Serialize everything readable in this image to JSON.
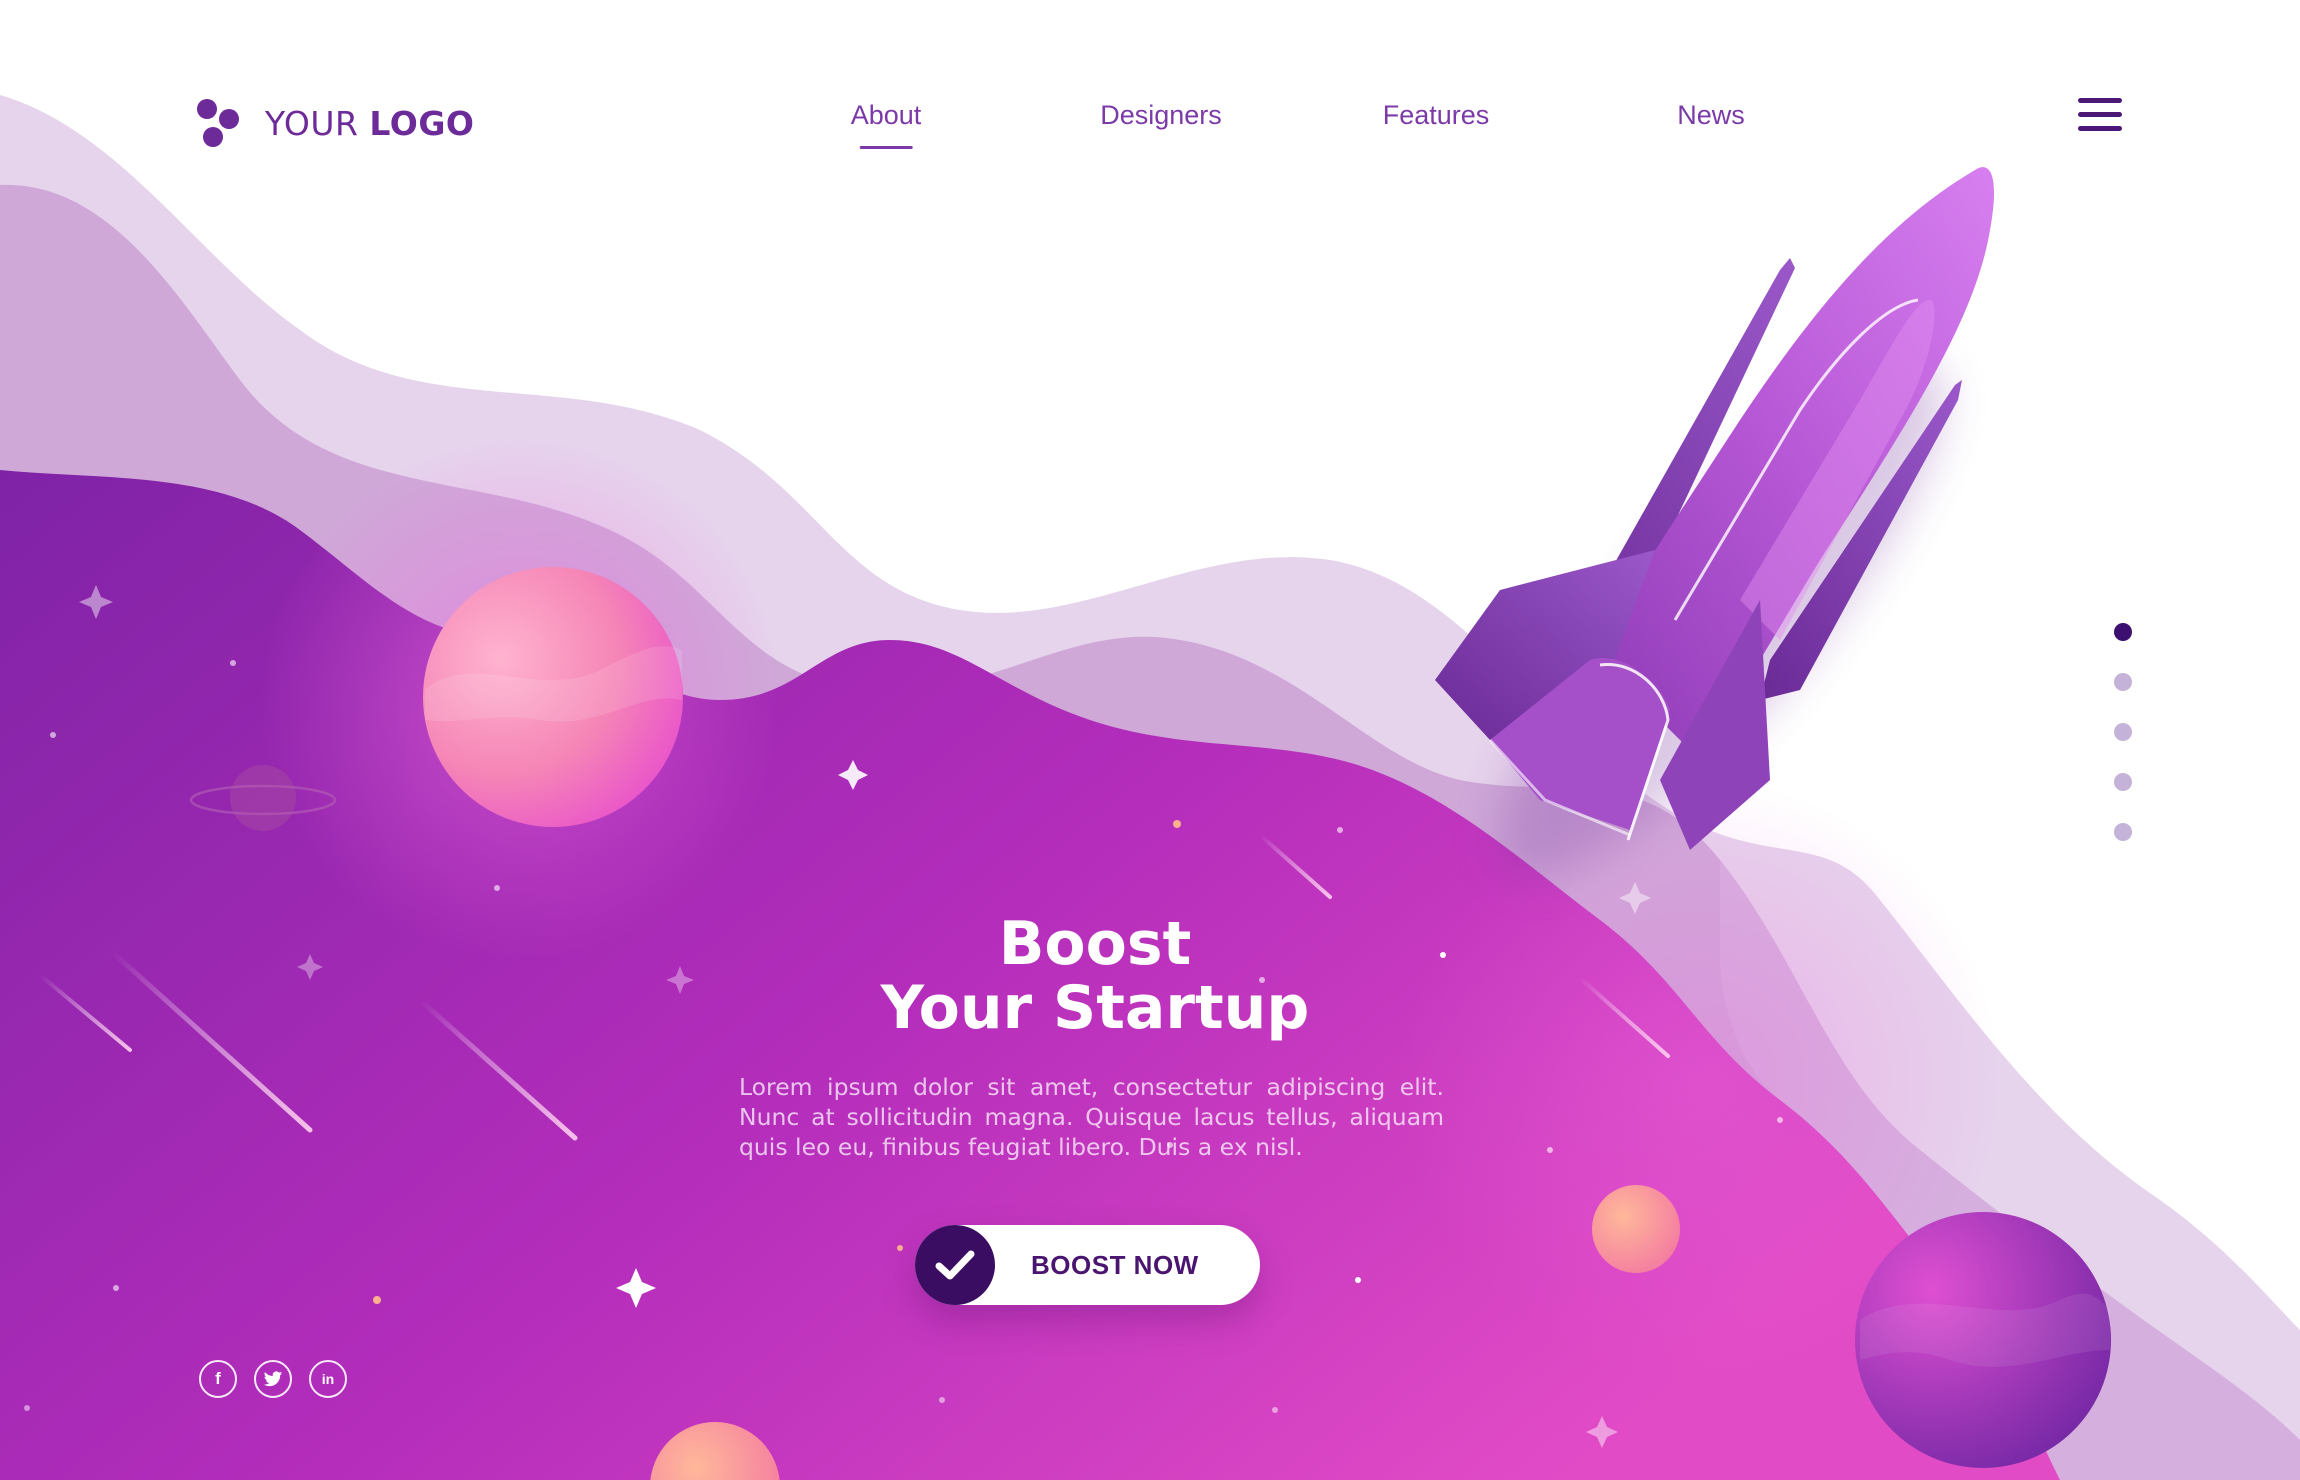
{
  "logo": {
    "text_regular": "YOUR",
    "text_bold": "LOGO"
  },
  "nav": {
    "items": [
      {
        "label": "About",
        "active": true
      },
      {
        "label": "Designers",
        "active": false
      },
      {
        "label": "Features",
        "active": false
      },
      {
        "label": "News",
        "active": false
      }
    ],
    "menu_icon": "hamburger-menu-icon"
  },
  "hero": {
    "title_line1": "Boost",
    "title_line2": "Your Startup",
    "body": "Lorem ipsum dolor sit amet, consectetur adipiscing elit. Nunc at sollicitudin magna. Quisque lacus tellus, aliquam quis leo eu, finibus feugiat libero. Duis a ex nisl.",
    "cta_label": "BOOST NOW",
    "cta_icon": "checkmark-icon"
  },
  "slider": {
    "count": 5,
    "active_index": 0
  },
  "social": [
    {
      "name": "facebook",
      "icon": "facebook-icon",
      "glyph": "f"
    },
    {
      "name": "twitter",
      "icon": "twitter-icon",
      "glyph": "t"
    },
    {
      "name": "linkedin",
      "icon": "linkedin-icon",
      "glyph": "in"
    }
  ],
  "colors": {
    "brand": "#6d2a99",
    "nav_text": "#7c3aa8",
    "dot_active": "#3c1070",
    "dot_inactive": "#c4b2d9",
    "cta_dark": "#3a0d62",
    "hero_purple": "#8e2ab0",
    "hero_pink": "#d43fc4"
  }
}
